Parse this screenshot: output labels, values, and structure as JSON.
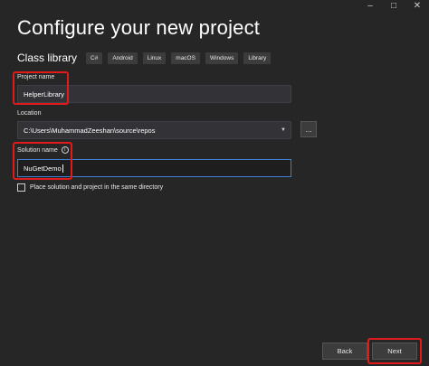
{
  "window": {
    "controls": {
      "minimize": "–",
      "maximize": "□",
      "close": "✕"
    }
  },
  "header": {
    "title": "Configure your new project"
  },
  "template": {
    "name": "Class library",
    "tags": [
      "C#",
      "Android",
      "Linux",
      "macOS",
      "Windows",
      "Library"
    ]
  },
  "form": {
    "project_name": {
      "label": "Project name",
      "value": "HelperLibrary"
    },
    "location": {
      "label": "Location",
      "value": "C:\\Users\\MuhammadZeeshan\\source\\repos",
      "browse_label": "..."
    },
    "solution_name": {
      "label": "Solution name",
      "info_icon": "i",
      "value": "NuGetDemo"
    },
    "same_directory": {
      "label": "Place solution and project in the same directory",
      "checked": false
    }
  },
  "footer": {
    "back_label": "Back",
    "next_label": "Next"
  },
  "colors": {
    "background": "#262626",
    "input_background": "#333337",
    "focus_border": "#3e7ed6",
    "highlight": "#e11b1b"
  }
}
